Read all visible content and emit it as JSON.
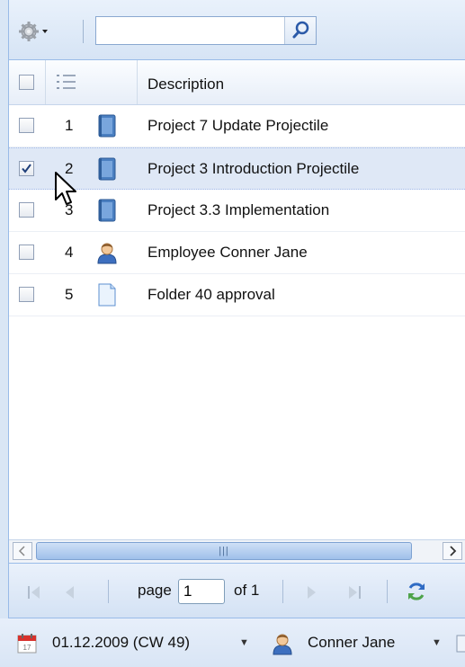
{
  "toolbar": {
    "gear_icon": "gear-icon",
    "search": {
      "value": "",
      "placeholder": ""
    },
    "search_icon": "search-icon"
  },
  "grid": {
    "columns": {
      "select": "",
      "number": "",
      "icon": "",
      "description": "Description"
    },
    "rows": [
      {
        "number": "1",
        "icon": "project-book-icon",
        "description": "Project 7 Update Projectile",
        "checked": false,
        "selected": false
      },
      {
        "number": "2",
        "icon": "project-book-icon",
        "description": "Project 3 Introduction Projectile",
        "checked": true,
        "selected": true
      },
      {
        "number": "3",
        "icon": "project-book-icon",
        "description": "Project 3.3 Implementation",
        "checked": false,
        "selected": false
      },
      {
        "number": "4",
        "icon": "employee-icon",
        "description": "Employee Conner Jane",
        "checked": false,
        "selected": false
      },
      {
        "number": "5",
        "icon": "document-icon",
        "description": "Folder 40 approval",
        "checked": false,
        "selected": false
      }
    ]
  },
  "paging": {
    "page_label": "page",
    "page_value": "1",
    "of_label": "of 1"
  },
  "status": {
    "date": "01.12.2009 (CW 49)",
    "user": "Conner Jane"
  },
  "colors": {
    "toolbar_bg": "#dae6f5",
    "selected_row": "#dfe8f6",
    "border": "#99bbe8"
  }
}
